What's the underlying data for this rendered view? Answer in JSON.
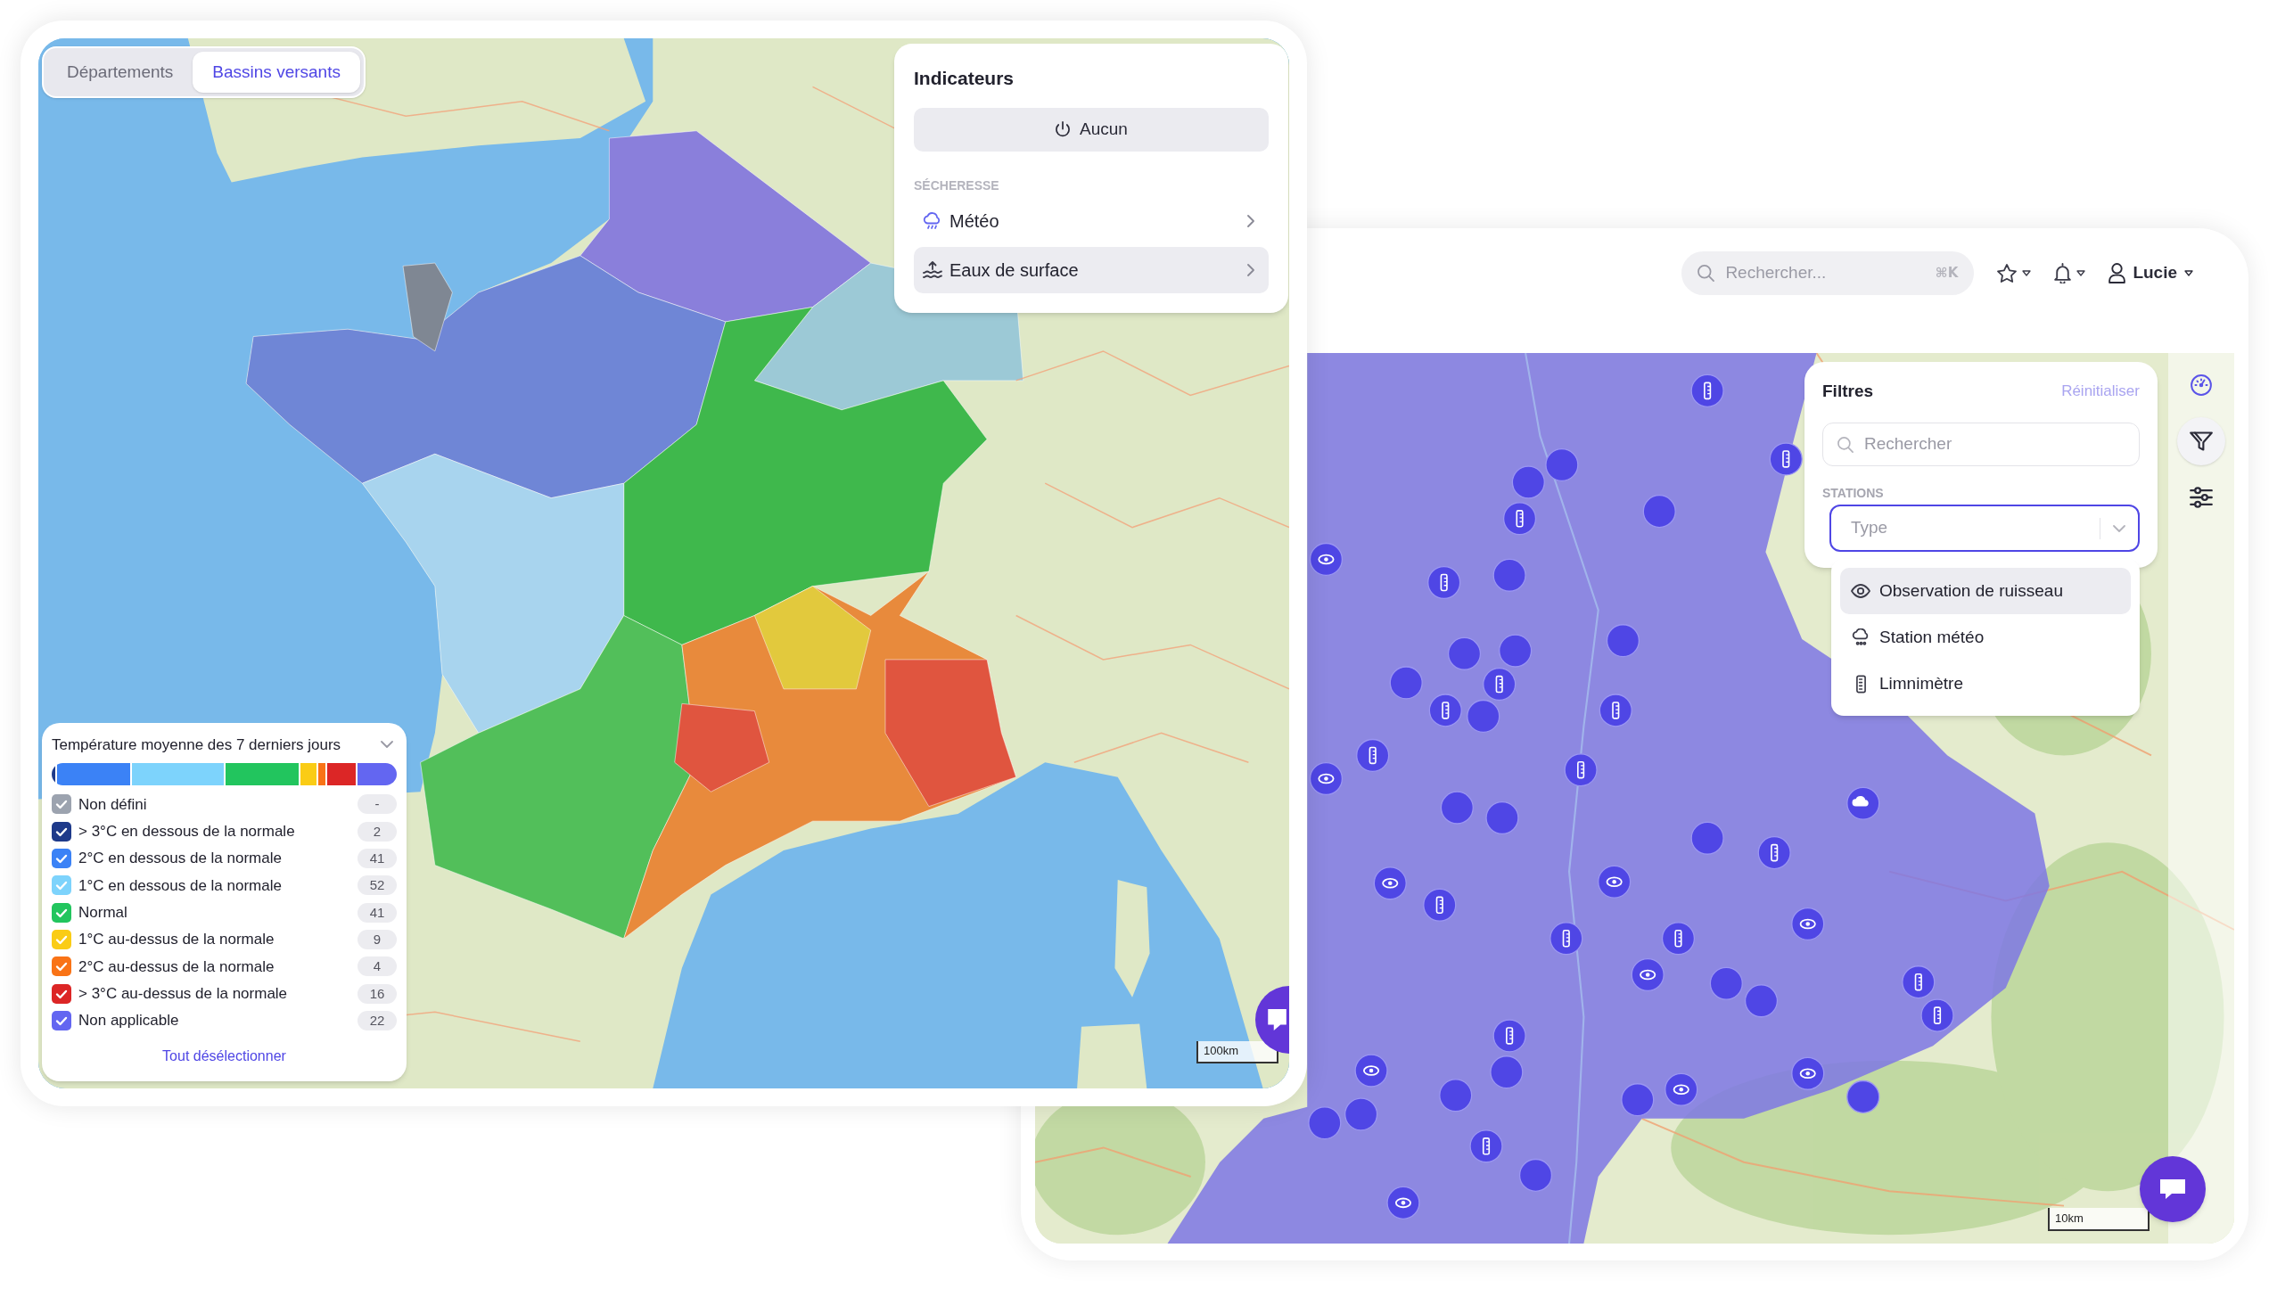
{
  "indicators_map": {
    "tabs": [
      {
        "label": "Départements",
        "selected": false
      },
      {
        "label": "Bassins versants",
        "selected": true
      }
    ],
    "indicators": {
      "title": "Indicateurs",
      "none_button": "Aucun",
      "section": "SÉCHERESSE",
      "items": [
        {
          "kind": "weather",
          "label": "Météo",
          "selected": false
        },
        {
          "kind": "surface_water",
          "label": "Eaux de surface",
          "selected": true
        }
      ]
    },
    "legend": {
      "title": "Température moyenne des 7 derniers jours",
      "items": [
        {
          "label": "Non défini",
          "count": "-",
          "checked": true,
          "color": "#9ca3af"
        },
        {
          "label": "> 3°C en dessous de la normale",
          "count": "2",
          "checked": true,
          "color": "#1e3a8a"
        },
        {
          "label": "2°C en dessous de la normale",
          "count": "41",
          "checked": true,
          "color": "#3b82f6"
        },
        {
          "label": "1°C en dessous de la normale",
          "count": "52",
          "checked": true,
          "color": "#7dd3fc"
        },
        {
          "label": "Normal",
          "count": "41",
          "checked": true,
          "color": "#22c55e"
        },
        {
          "label": "1°C au-dessus de la normale",
          "count": "9",
          "checked": true,
          "color": "#facc15"
        },
        {
          "label": "2°C au-dessus de la normale",
          "count": "4",
          "checked": true,
          "color": "#f97316"
        },
        {
          "label": "> 3°C au-dessus de la normale",
          "count": "16",
          "checked": true,
          "color": "#dc2626"
        },
        {
          "label": "Non applicable",
          "count": "22",
          "checked": true,
          "color": "#6366f1"
        }
      ],
      "deselect_all": "Tout désélectionner"
    },
    "scale": "100km"
  },
  "stations_map": {
    "search": {
      "placeholder": "Rechercher...",
      "shortcut": "⌘K"
    },
    "user": "Lucie",
    "filters": {
      "title": "Filtres",
      "reset": "Réinitialiser",
      "search_placeholder": "Rechercher",
      "section": "STATIONS",
      "type_placeholder": "Type",
      "options": [
        {
          "kind": "observation",
          "label": "Observation de ruisseau",
          "selected": true
        },
        {
          "kind": "weather_station",
          "label": "Station météo",
          "selected": false
        },
        {
          "kind": "gauge",
          "label": "Limnimètre",
          "selected": false
        }
      ]
    },
    "tools": [
      {
        "kind": "gauge",
        "selected": false
      },
      {
        "kind": "filter",
        "selected": true
      },
      {
        "kind": "sliders",
        "selected": false
      }
    ],
    "scale": "10km"
  }
}
